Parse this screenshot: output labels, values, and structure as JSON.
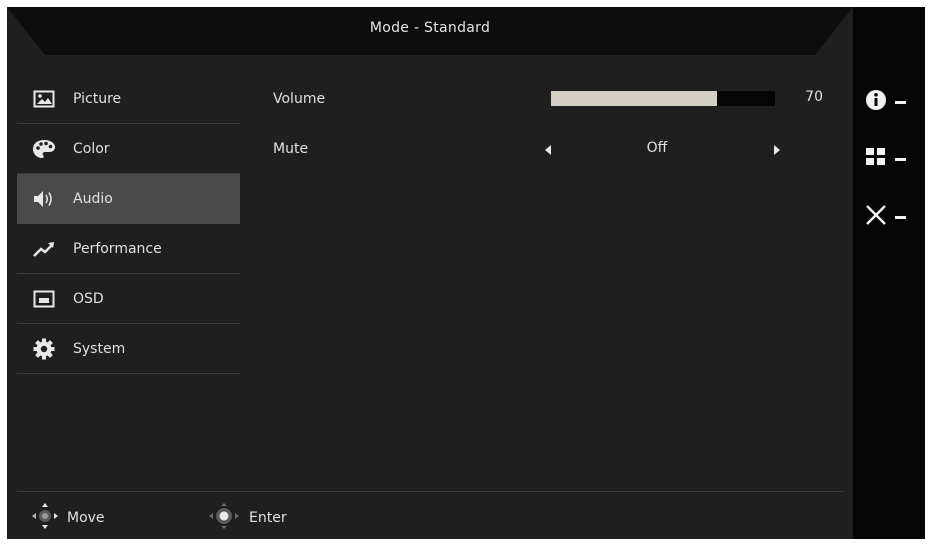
{
  "header": {
    "title": "Mode - Standard"
  },
  "menu": {
    "items": [
      {
        "label": "Picture",
        "icon": "picture-icon",
        "selected": false
      },
      {
        "label": "Color",
        "icon": "palette-icon",
        "selected": false
      },
      {
        "label": "Audio",
        "icon": "speaker-icon",
        "selected": true
      },
      {
        "label": "Performance",
        "icon": "trending-up-icon",
        "selected": false
      },
      {
        "label": "OSD",
        "icon": "osd-window-icon",
        "selected": false
      },
      {
        "label": "System",
        "icon": "gear-icon",
        "selected": false
      }
    ]
  },
  "audio": {
    "volume_label": "Volume",
    "volume_value": "70",
    "volume_level": 0.74,
    "mute_label": "Mute",
    "mute_value": "Off"
  },
  "side_buttons": [
    {
      "icon": "info-icon"
    },
    {
      "icon": "grid-icon"
    },
    {
      "icon": "close-icon"
    }
  ],
  "footer": {
    "move_label": "Move",
    "enter_label": "Enter"
  },
  "colors": {
    "background": "#1f1f1f",
    "panel": "#050505",
    "selected": "#4a4a4a",
    "volume_fill": "#d4cfc4"
  }
}
